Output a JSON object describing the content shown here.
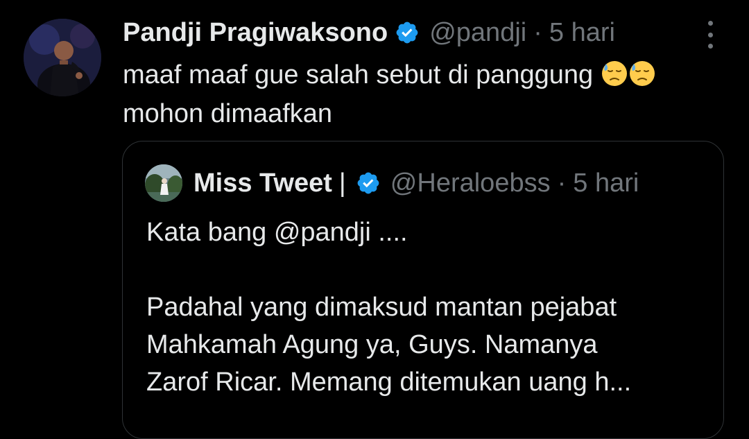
{
  "tweet": {
    "display_name": "Pandji Pragiwaksono",
    "handle": "@pandji",
    "separator": "·",
    "time": "5 hari",
    "text_line1": "maaf maaf gue salah sebut di panggung",
    "text_line2": "mohon dimaafkan",
    "emojis": [
      "downcast-face-with-sweat-emoji",
      "downcast-face-with-sweat-emoji"
    ],
    "verified_icon": "verified-badge-icon",
    "more_icon": "more-options-icon"
  },
  "quoted_tweet": {
    "display_name": "Miss Tweet",
    "name_suffix": "|",
    "handle": "@Heraloebss",
    "separator": "·",
    "time": "5 hari",
    "paragraph1": "Kata bang @pandji ....",
    "paragraph2_line1": "Padahal yang dimaksud mantan pejabat",
    "paragraph2_line2": "Mahkamah Agung ya, Guys. Namanya",
    "paragraph2_line3": "Zarof Ricar. Memang ditemukan uang h..."
  },
  "colors": {
    "background": "#000000",
    "text": "#e7e9ea",
    "secondary_text": "#71767b",
    "verified_blue": "#1d9bf0",
    "border": "#2f3336"
  }
}
